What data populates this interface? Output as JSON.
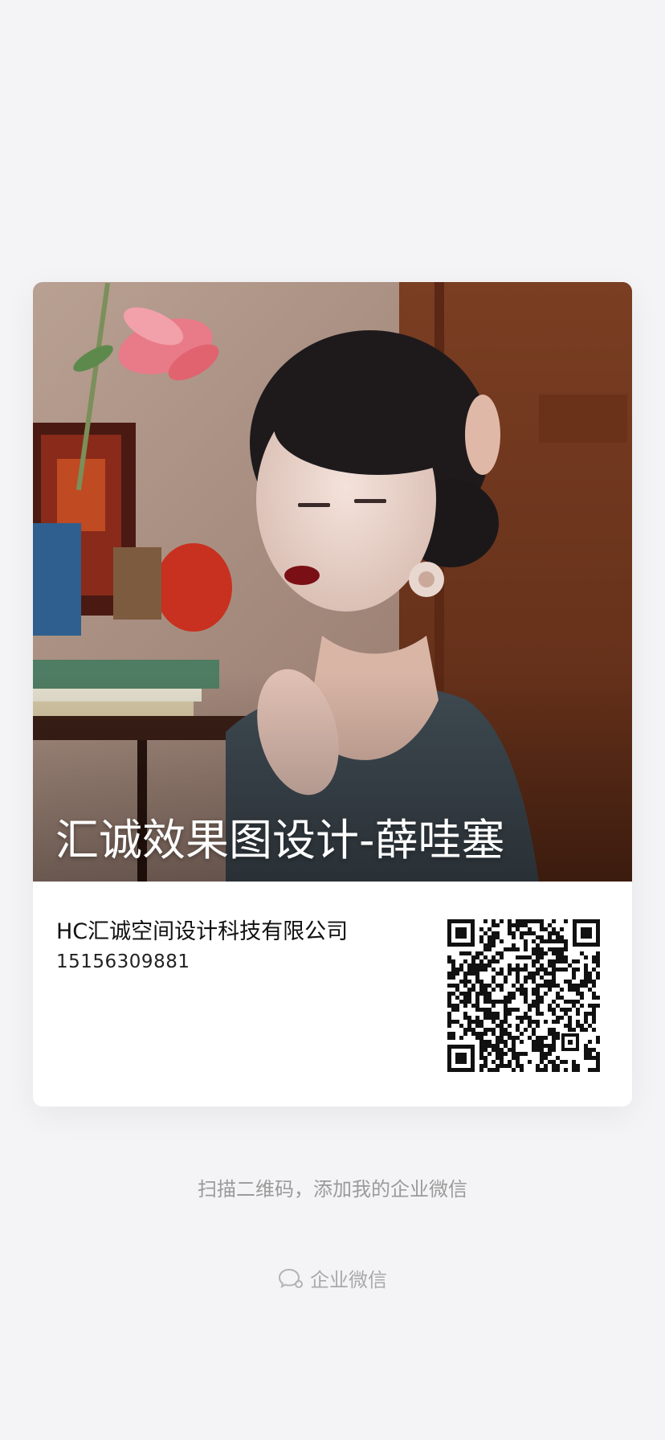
{
  "card": {
    "display_name": "汇诚效果图设计-薛哇塞",
    "company": "HC汇诚空间设计科技有限公司",
    "phone": "15156309881"
  },
  "qr": {
    "icon": "qr-code-icon"
  },
  "hint": "扫描二维码，添加我的企业微信",
  "footer": {
    "icon": "wecom-chat-icon",
    "brand": "企业微信"
  }
}
